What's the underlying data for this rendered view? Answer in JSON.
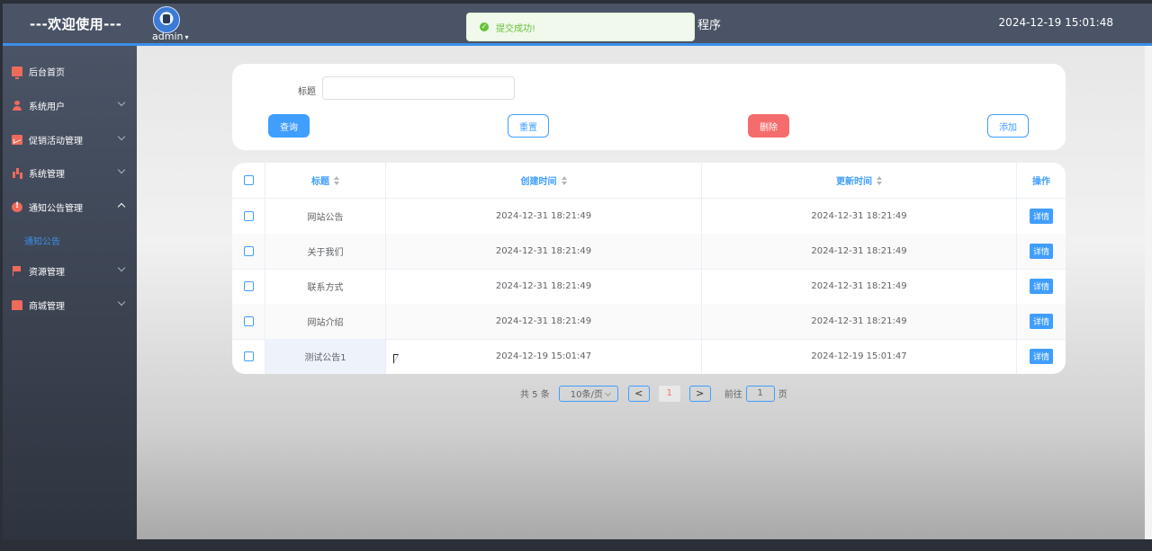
{
  "header": {
    "brand": "---欢迎使用---",
    "username": "admin",
    "title_tail": "程序",
    "datetime": "2024-12-19 15:01:48"
  },
  "toast": {
    "message": "提交成功!"
  },
  "sidebar": {
    "items": [
      {
        "label": "后台首页",
        "icon": "monitor-icon"
      },
      {
        "label": "系统用户",
        "icon": "user-icon"
      },
      {
        "label": "促销活动管理",
        "icon": "chart-icon"
      },
      {
        "label": "系统管理",
        "icon": "bar-chart-icon"
      },
      {
        "label": "通知公告管理",
        "icon": "alert-icon"
      },
      {
        "label": "资源管理",
        "icon": "flag-icon"
      },
      {
        "label": "商城管理",
        "icon": "shop-icon"
      }
    ],
    "sub_item": "通知公告"
  },
  "search": {
    "label": "标题",
    "placeholder": "",
    "value": "",
    "query_label": "查询",
    "reset_label": "重置",
    "delete_label": "删除",
    "add_label": "添加"
  },
  "table": {
    "columns": [
      "标题",
      "创建时间",
      "更新时间",
      "操作"
    ],
    "detail_label": "详情",
    "rows": [
      {
        "title": "网站公告",
        "created": "2024-12-31 18:21:49",
        "updated": "2024-12-31 18:21:49"
      },
      {
        "title": "关于我们",
        "created": "2024-12-31 18:21:49",
        "updated": "2024-12-31 18:21:49"
      },
      {
        "title": "联系方式",
        "created": "2024-12-31 18:21:49",
        "updated": "2024-12-31 18:21:49"
      },
      {
        "title": "网站介绍",
        "created": "2024-12-31 18:21:49",
        "updated": "2024-12-31 18:21:49"
      },
      {
        "title": "测试公告1",
        "created": "2024-12-19 15:01:47",
        "updated": "2024-12-19 15:01:47"
      }
    ]
  },
  "pagination": {
    "total": "共 5 条",
    "page_size": "10条/页",
    "prev": "<",
    "current": "1",
    "next": ">",
    "goto_label": "前往",
    "goto_value": "1",
    "page_unit": "页"
  },
  "colors": {
    "accent": "#409eff",
    "danger": "#f56c6c",
    "success": "#67c23a",
    "header_bg": "#4a5466"
  }
}
